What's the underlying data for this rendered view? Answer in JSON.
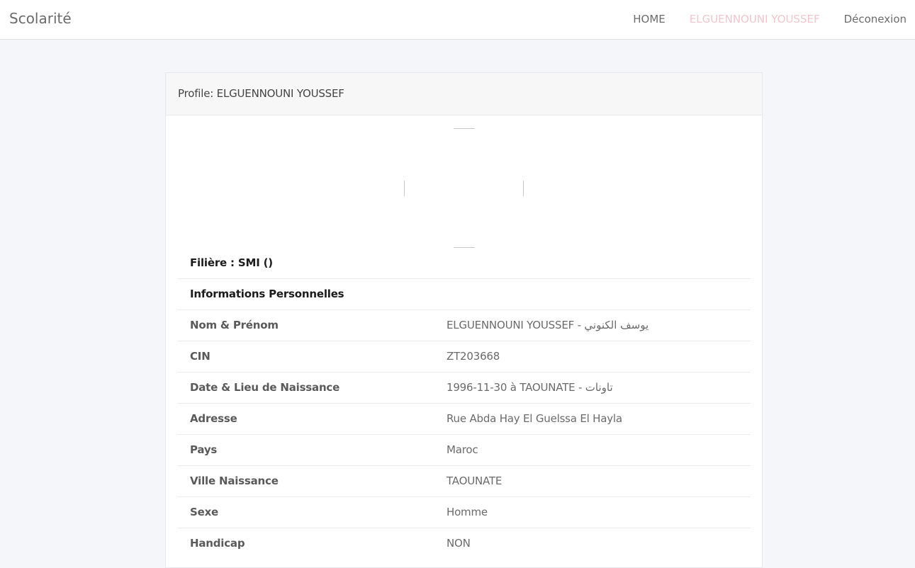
{
  "navbar": {
    "brand": "Scolarité",
    "links": [
      {
        "label": "HOME"
      },
      {
        "label": "ELGUENNOUNI YOUSSEF"
      },
      {
        "label": "Déconexion"
      }
    ],
    "active_color": "#f2c5cf"
  },
  "profile": {
    "header": "Profile: ELGUENNOUNI YOUSSEF",
    "filiere": "Filière : SMI ()",
    "section_title": "Informations Personnelles",
    "rows": [
      {
        "label": "Nom & Prénom",
        "value": "ELGUENNOUNI YOUSSEF - يوسف الكنوني"
      },
      {
        "label": "CIN",
        "value": "ZT203668"
      },
      {
        "label": "Date & Lieu de Naissance",
        "value": "1996-11-30 à TAOUNATE - تاونات"
      },
      {
        "label": "Adresse",
        "value": "Rue Abda Hay El Guelssa El Hayla"
      },
      {
        "label": "Pays",
        "value": "Maroc"
      },
      {
        "label": "Ville Naissance",
        "value": "TAOUNATE"
      },
      {
        "label": "Sexe",
        "value": "Homme"
      },
      {
        "label": "Handicap",
        "value": "NON"
      }
    ]
  }
}
